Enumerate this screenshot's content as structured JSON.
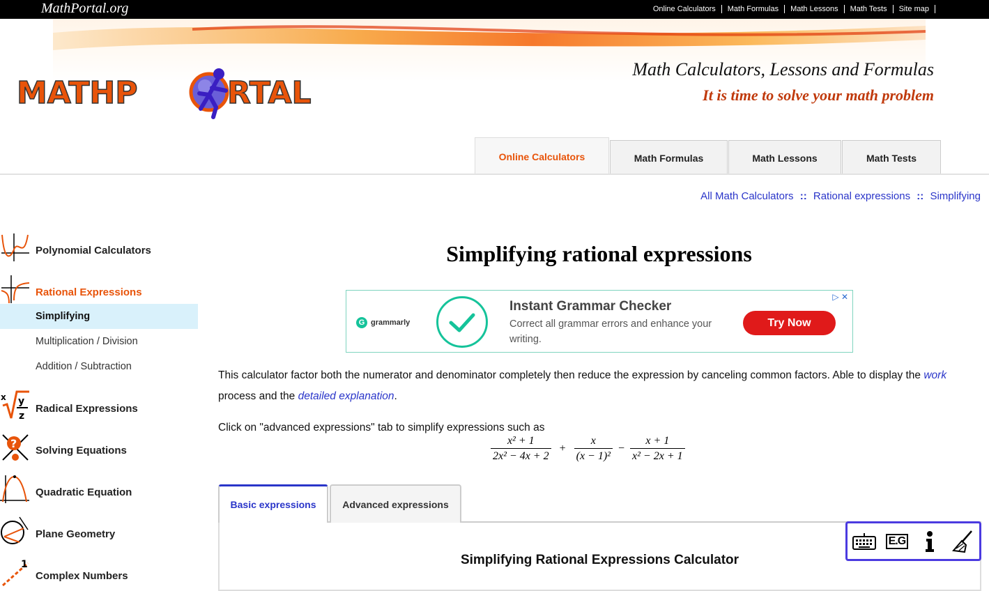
{
  "topbar": {
    "site_name": "MathPortal.org",
    "nav": [
      "Online Calculators",
      "Math Formulas",
      "Math Lessons",
      "Math Tests",
      "Site map"
    ]
  },
  "header": {
    "logo_text": "MATHPORTAL",
    "tagline": "Math Calculators, Lessons and Formulas",
    "subtagline": "It is time to solve your math problem"
  },
  "main_tabs": [
    "Online Calculators",
    "Math Formulas",
    "Math Lessons",
    "Math Tests"
  ],
  "breadcrumb": {
    "items": [
      "All Math Calculators",
      "Rational expressions",
      "Simplifying"
    ],
    "separator": "::"
  },
  "sidebar": {
    "categories": [
      {
        "label": "Polynomial Calculators",
        "icon": "polynomial-graph-icon"
      },
      {
        "label": "Rational Expressions",
        "icon": "rational-graph-icon"
      },
      {
        "label": "Radical Expressions",
        "icon": "radical-icon"
      },
      {
        "label": "Solving Equations",
        "icon": "solving-equations-icon"
      },
      {
        "label": "Quadratic Equation",
        "icon": "parabola-icon"
      },
      {
        "label": "Plane Geometry",
        "icon": "geometry-icon"
      },
      {
        "label": "Complex Numbers",
        "icon": "complex-numbers-icon"
      }
    ],
    "subitems": [
      "Simplifying",
      "Multiplication / Division",
      "Addition / Subtraction"
    ]
  },
  "page": {
    "title": "Simplifying rational expressions",
    "desc_before": "This calculator factor both the numerator and denominator completely then reduce the expression by canceling common factors. Able to display the ",
    "link_work": "work",
    "desc_middle": " process and the ",
    "link_detailed": "detailed explanation",
    "desc_end": ".",
    "advanced_hint": "Click on \"advanced expressions\" tab to simplify expressions such as"
  },
  "formula": {
    "f1_num": "x² + 1",
    "f1_den": "2x² − 4x + 2",
    "op1": "+",
    "f2_num": "x",
    "f2_den": "(x − 1)²",
    "op2": "−",
    "f3_num": "x + 1",
    "f3_den": "x² − 2x + 1"
  },
  "ad": {
    "brand": "grammarly",
    "headline": "Instant Grammar Checker",
    "description": "Correct all grammar errors and enhance your writing.",
    "cta": "Try Now"
  },
  "calc": {
    "tabs": [
      "Basic expressions",
      "Advanced expressions"
    ],
    "title": "Simplifying Rational Expressions Calculator"
  },
  "toolbar": {
    "icons": [
      "keyboard-icon",
      "examples-icon",
      "info-icon",
      "clear-broom-icon"
    ],
    "examples_label": "E.G"
  },
  "colors": {
    "accent_orange": "#e8540a",
    "link_blue": "#2a35c9",
    "tagline_red": "#c0390b",
    "selected_bg": "#d9f1fb"
  }
}
